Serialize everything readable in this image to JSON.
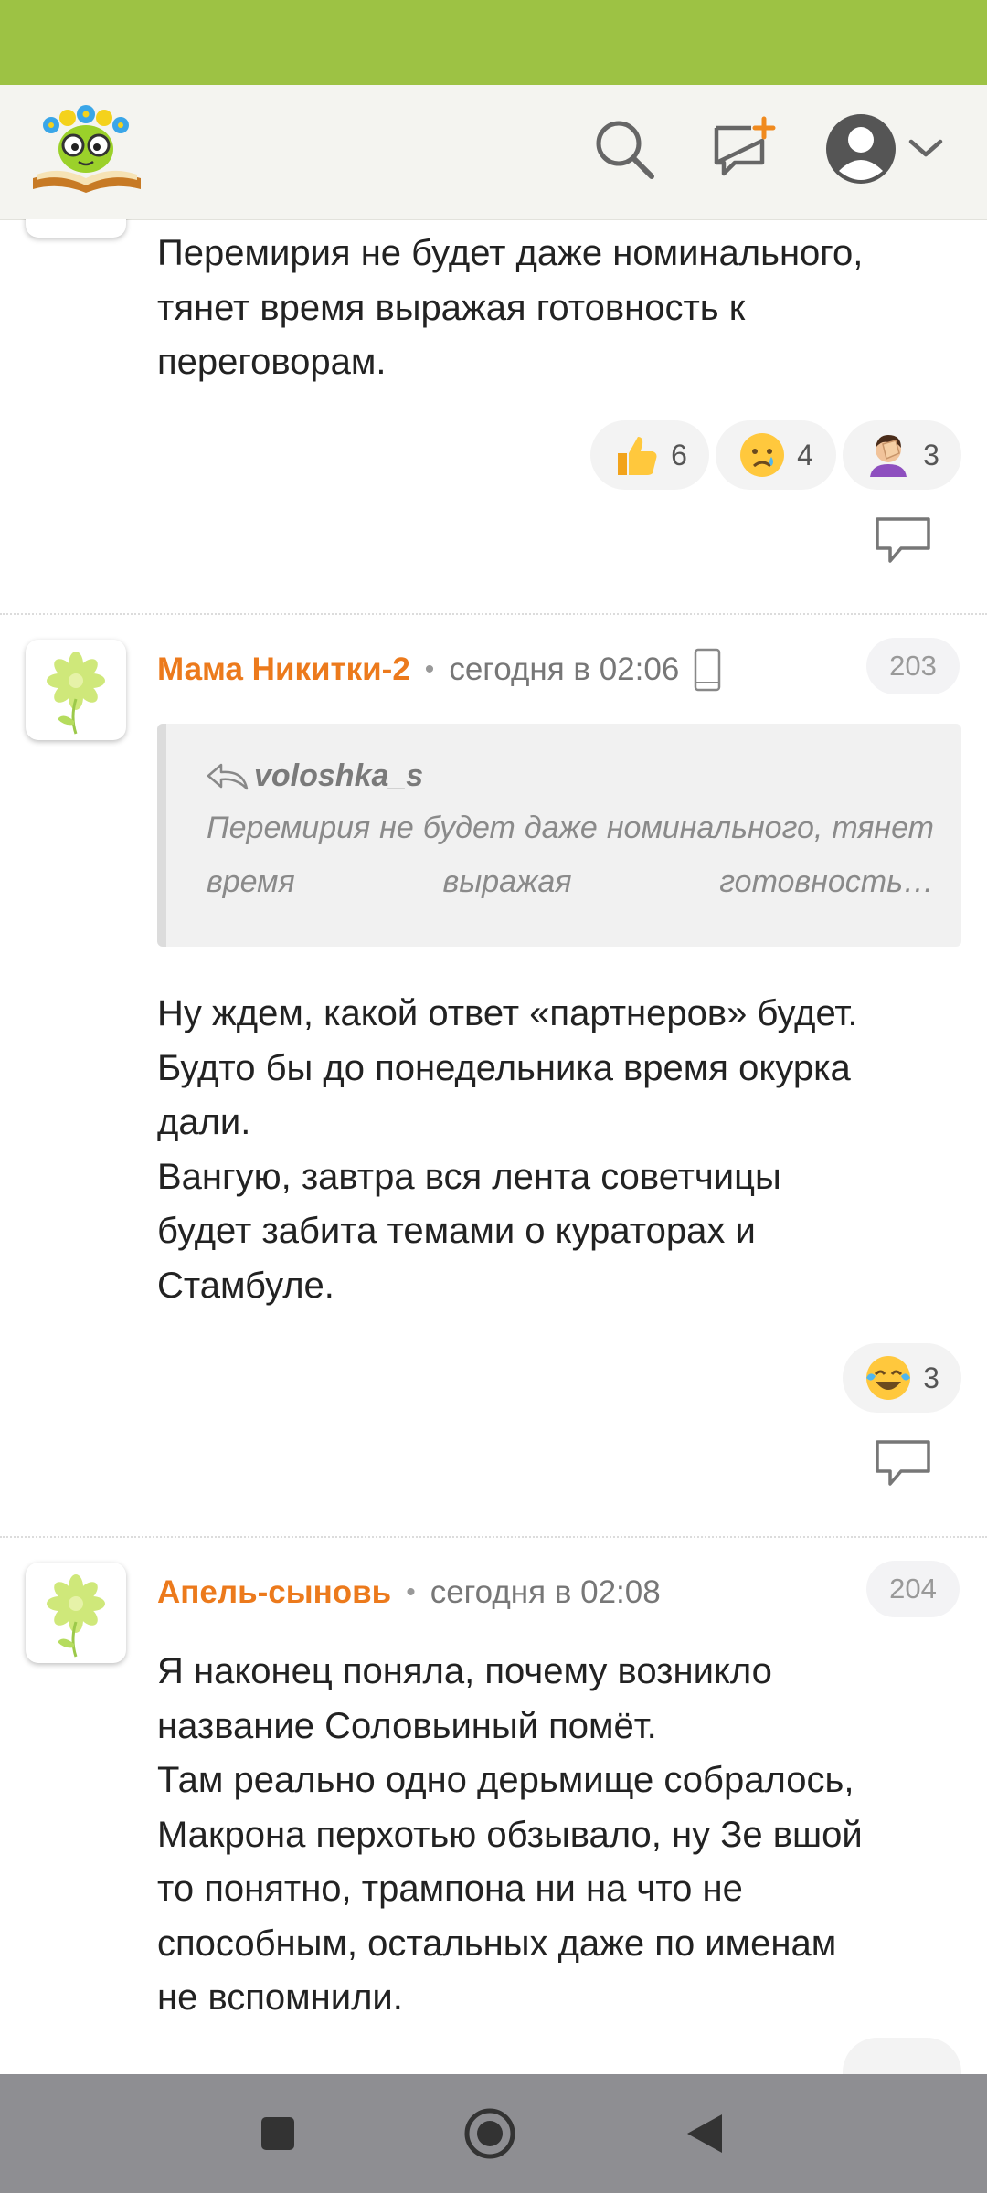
{
  "colors": {
    "status_bar": "#9dc244",
    "author": "#ec7a1c",
    "navbar": "#8e8e92"
  },
  "header": {
    "icons": [
      "logo-icon",
      "search-icon",
      "new-post-icon",
      "avatar-icon",
      "chevron-down-icon"
    ]
  },
  "prev_comment": {
    "text": "Перемирия не будет даже номинального,\nтянет время выражая готовность к\nпереговорам.",
    "reactions": [
      {
        "emoji": "thumbs-up-icon",
        "count": "6"
      },
      {
        "emoji": "crying-face-icon",
        "count": "4"
      },
      {
        "emoji": "facepalm-icon",
        "count": "3"
      }
    ]
  },
  "comments": [
    {
      "author": "Мама Никитки-2",
      "time": "сегодня в 02:06",
      "device_icon": "phone-icon",
      "number": "203",
      "quote": {
        "author": "voloshka_s",
        "text": "Перемирия не будет даже номинального, тянет время выражая готовность…"
      },
      "text": "Ну ждем, какой ответ «партнеров» будет.\nБудто бы до понедельника время окурка\nдали.\nВангую, завтра вся лента советчицы\nбудет забита темами о кураторах и\nСтамбуле.",
      "reactions": [
        {
          "emoji": "tears-of-joy-icon",
          "count": "3"
        }
      ]
    },
    {
      "author": "Апель-сыновь",
      "time": "сегодня в 02:08",
      "number": "204",
      "text": "Я наконец поняла, почему возникло\nназвание Соловьиный помёт.\nТам реально одно дерьмище собралось,\nМакрона перхотью обзывало, ну Зе вшой\nто понятно, трампона ни на что не\nспособным, остальных даже по именам\nне вспомнили."
    }
  ],
  "navbar": {
    "icons": [
      "recent-apps-icon",
      "home-icon",
      "back-icon"
    ]
  }
}
